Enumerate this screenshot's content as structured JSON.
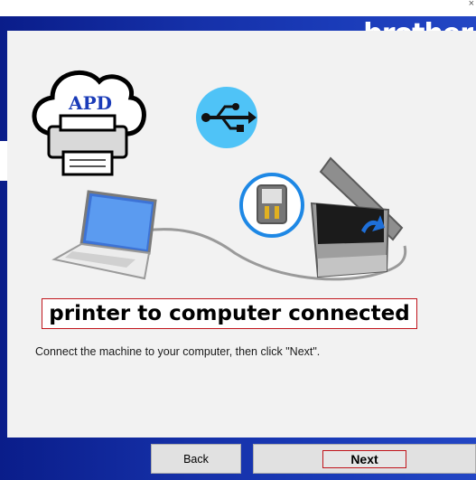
{
  "window": {
    "close_glyph": "×"
  },
  "brand": {
    "name": "brother"
  },
  "logo": {
    "text": "APD"
  },
  "headline": "printer to computer connected",
  "instruction": "Connect the machine to your computer, then click \"Next\".",
  "buttons": {
    "back": "Back",
    "next": "Next"
  },
  "icons": [
    "cloud-printer-logo-icon",
    "usb-icon",
    "laptop-icon",
    "usb-port-icon",
    "printer-icon",
    "arrow-icon"
  ],
  "colors": {
    "frame": "#1530a8",
    "highlight_border": "#c0141b",
    "usb_circle": "#4fc3f7"
  }
}
